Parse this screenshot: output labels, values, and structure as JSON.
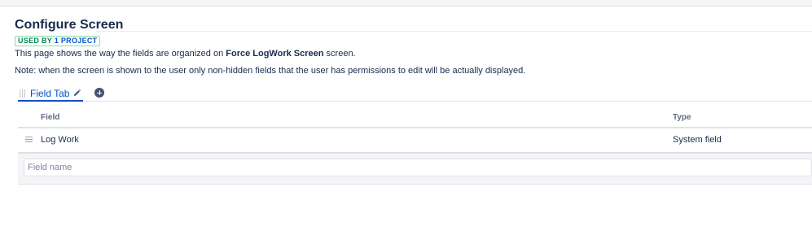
{
  "page": {
    "title": "Configure Screen",
    "lozenge": {
      "used_text": "USED BY ",
      "project_text": "1 PROJECT"
    },
    "description": {
      "prefix": "This page shows the way the fields are organized on ",
      "screen_name": "Force LogWork Screen",
      "suffix": " screen."
    },
    "note": "Note: when the screen is shown to the user only non-hidden fields that the user has permissions to edit will be actually displayed."
  },
  "tabs": [
    {
      "label": "Field Tab",
      "active": true
    }
  ],
  "table": {
    "headers": {
      "field": "Field",
      "type": "Type"
    },
    "rows": [
      {
        "field": "Log Work",
        "type": "System field"
      }
    ],
    "add_field": {
      "placeholder": "Field name",
      "value": ""
    }
  },
  "colors": {
    "accent": "#0052cc",
    "lozenge_green": "#00875a",
    "text": "#172b4d",
    "subtle": "#5e6c84"
  },
  "icons": [
    "grip-icon",
    "pencil-icon",
    "add-tab-icon",
    "drag-handle-icon"
  ]
}
